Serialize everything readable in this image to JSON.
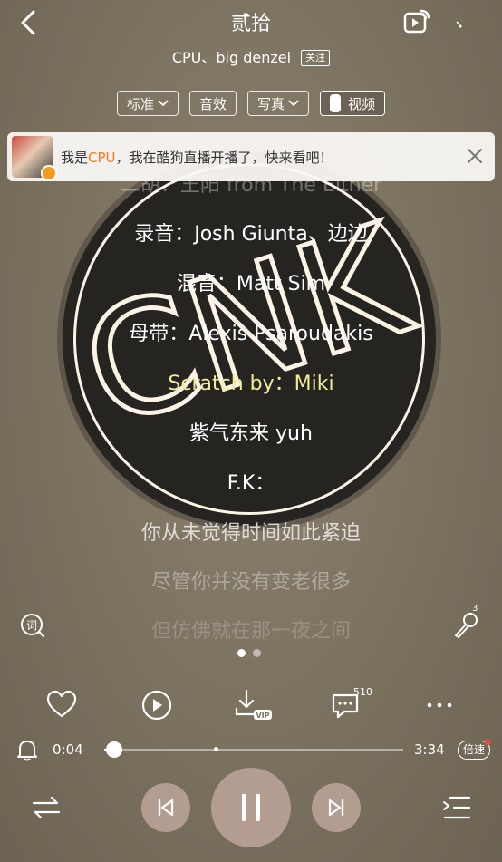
{
  "header": {
    "title": "贰拾",
    "artist": "CPU、big denzel",
    "follow_label": "关注"
  },
  "chips": {
    "quality": "标准",
    "effects": "音效",
    "photos": "写真",
    "video": "视频"
  },
  "banner": {
    "prefix": "我是",
    "highlight": "CPU",
    "suffix": "，我在酷狗直播开播了，快来看吧！"
  },
  "lyrics": {
    "line0": "二胡：王阳 from The Either",
    "line1": "录音：Josh Giunta、边边",
    "line2": "混音：Matt Sim",
    "line3": "母带：Alexis Psaroudakis",
    "line4": "Scratch by：Miki",
    "line5": "紫气东来 yuh",
    "line6": "F.K：",
    "line7": "你从未觉得时间如此紧迫",
    "line8": "尽管你并没有变老很多",
    "line9": "但仿佛就在那一夜之间"
  },
  "side": {
    "mic_count": "3"
  },
  "actions": {
    "comment_count": "510"
  },
  "progress": {
    "current": "0:04",
    "total": "3:34",
    "fraction": 0.02,
    "speed_label": "倍速"
  },
  "colors": {
    "active_lyric": "#f1eb9a",
    "banner_highlight": "#f07a1d"
  },
  "album_art_text": "CNK"
}
